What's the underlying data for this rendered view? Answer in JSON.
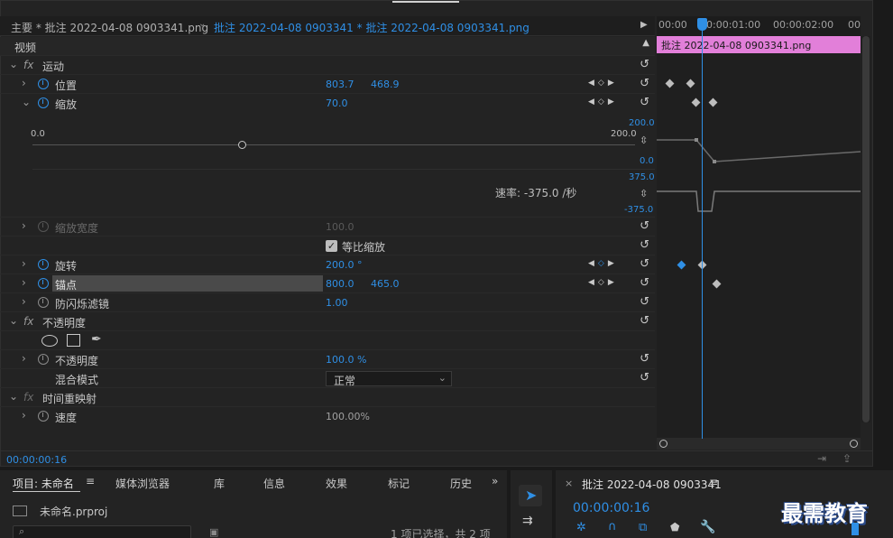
{
  "tabs": {
    "master": "主要 * 批注 2022-04-08  0903341.png",
    "active": "批注 2022-04-08  0903341 * 批注 2022-04-08  0903341.png"
  },
  "timeline": {
    "ruler": [
      "00:00",
      "00:00:01:00",
      "00:00:02:00",
      "00"
    ],
    "clip": "批注 2022-04-08  0903341.png",
    "graph_scale": {
      "top": "200.0",
      "bottom": "0.0",
      "vel_top": "375.0",
      "vel_bottom": "-375.0"
    }
  },
  "effects": {
    "video": "视频",
    "motion": "运动",
    "position": {
      "label": "位置",
      "x": "803.7",
      "y": "468.9"
    },
    "scale": {
      "label": "缩放",
      "value": "70.0",
      "slider_min": "0.0",
      "slider_max": "200.0",
      "velocity": "速率: -375.0 /秒"
    },
    "scale_width": {
      "label": "缩放宽度",
      "value": "100.0"
    },
    "uniform": {
      "label": "等比缩放"
    },
    "rotation": {
      "label": "旋转",
      "value": "200.0 °"
    },
    "anchor": {
      "label": "锚点",
      "x": "800.0",
      "y": "465.0"
    },
    "flicker": {
      "label": "防闪烁滤镜",
      "value": "1.00"
    },
    "opacity_group": "不透明度",
    "opacity": {
      "label": "不透明度",
      "value": "100.0 %"
    },
    "blend": {
      "label": "混合模式",
      "value": "正常"
    },
    "time_remap": "时间重映射",
    "speed": {
      "label": "速度",
      "value": "100.00%"
    }
  },
  "fx_symbol": "fx",
  "status_time": "00:00:00:16",
  "project": {
    "tabs": [
      "项目: 未命名",
      "媒体浏览器",
      "库",
      "信息",
      "效果",
      "标记",
      "历史"
    ],
    "file": "未命名.prproj",
    "selection": "1 项已选择，共 2 项"
  },
  "program": {
    "title": "批注 2022-04-08  0903341",
    "timecode": "00:00:00:16"
  },
  "watermark": "最需教育"
}
